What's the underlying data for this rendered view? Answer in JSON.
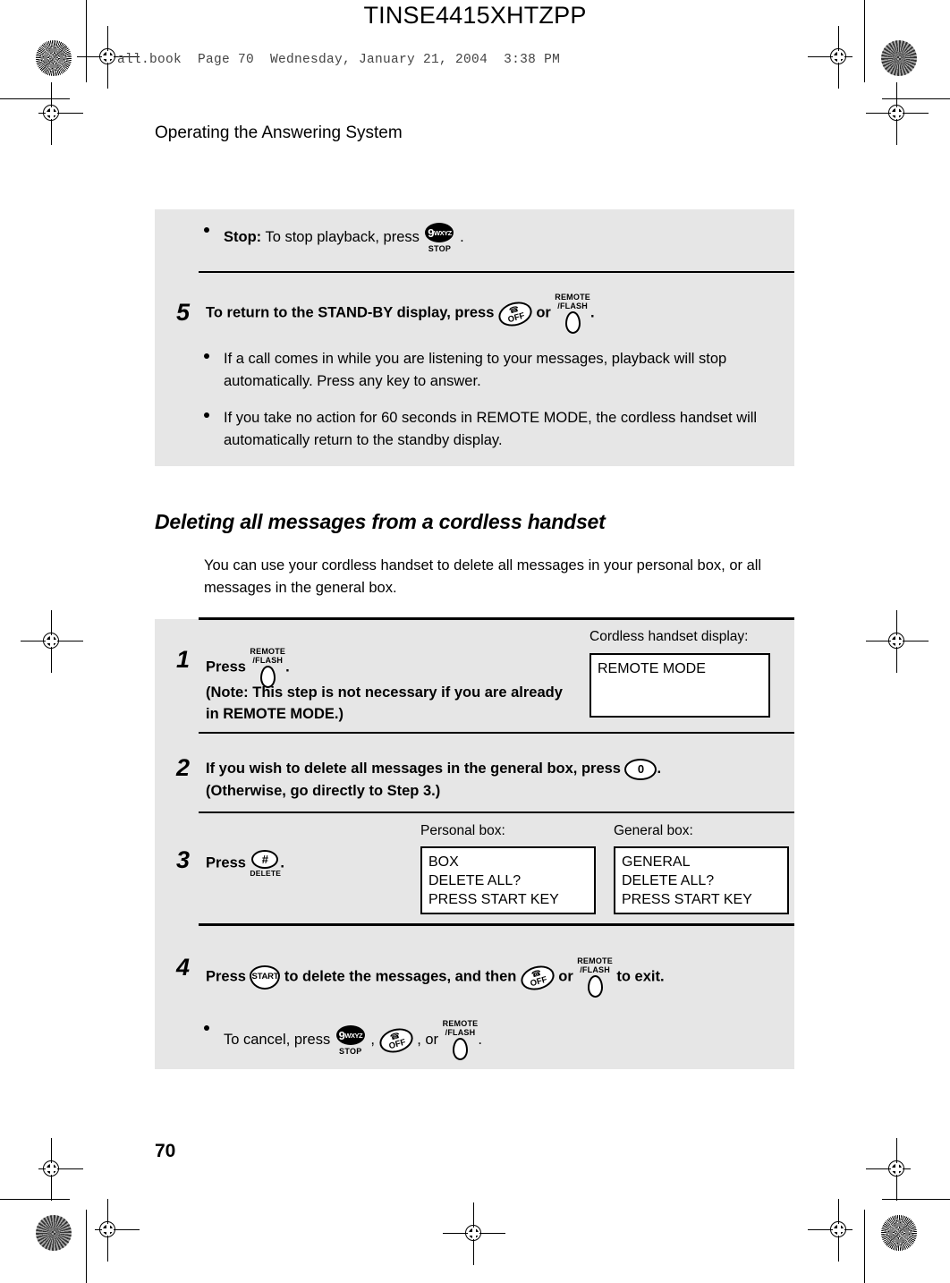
{
  "header": {
    "doc_code": "TINSE4415XHTZPP",
    "file_stamp": "all.book  Page 70  Wednesday, January 21, 2004  3:38 PM",
    "running_head": "Operating the Answering System"
  },
  "panel_top": {
    "stop_bullet": {
      "label": "Stop:",
      "text_before": "To stop playback, press",
      "key": "9-wxyz-stop-key",
      "text_after": "."
    },
    "step5": {
      "number": "5",
      "text_before": "To return to the STAND-BY display, press",
      "key1": "off-key",
      "conjunction": "or",
      "key2": "remote-flash-key",
      "text_after": ".",
      "bullets": [
        "If a call comes in while you are listening to your messages, playback will stop automatically. Press any key to answer.",
        "If you take no action for 60 seconds in REMOTE MODE, the cordless handset will automatically return to the standby display."
      ]
    }
  },
  "section": {
    "heading": "Deleting all messages from a cordless handset",
    "intro": "You can use your cordless handset to delete all messages in your personal box, or all messages in the general box."
  },
  "panel_steps": {
    "step1": {
      "number": "1",
      "press_label": "Press",
      "key": "remote-flash-key",
      "after_key": ".",
      "note": "(Note: This step is not necessary if you are already in REMOTE MODE.)",
      "display_label": "Cordless handset display:",
      "display_lines": [
        "REMOTE MODE"
      ]
    },
    "step2": {
      "number": "2",
      "text_before": "If you wish to delete all messages in the general box, press",
      "key": "zero-key",
      "text_after": ".",
      "line2": "(Otherwise, go directly to Step 3.)"
    },
    "step3": {
      "number": "3",
      "press_label": "Press",
      "key": "pound-delete-key",
      "after_key": ".",
      "personal_label": "Personal box:",
      "personal_lines": [
        "BOX",
        "DELETE ALL?",
        "PRESS START KEY"
      ],
      "general_label": "General box:",
      "general_lines": [
        "GENERAL",
        "DELETE ALL?",
        "PRESS START KEY"
      ]
    },
    "step4": {
      "number": "4",
      "press_label": "Press",
      "key_start": "start-key",
      "text_mid": "to delete the messages, and then",
      "key_off": "off-key",
      "conjunction": "or",
      "key_remote": "remote-flash-key",
      "text_end": "to exit.",
      "cancel_before": "To cancel, press",
      "cancel_k1": "9-wxyz-stop-key",
      "cancel_sep1": ",",
      "cancel_k2": "off-key",
      "cancel_sep2": ", or",
      "cancel_k3": "remote-flash-key",
      "cancel_end": "."
    }
  },
  "footer": {
    "page_number": "70"
  },
  "keys": {
    "nine": "9",
    "nine_sup": "WXYZ",
    "stop": "STOP",
    "off_label": "OFF",
    "phone_glyph": "☎",
    "remote_line1": "REMOTE",
    "remote_line2": "/FLASH",
    "zero": "0",
    "pound": "#",
    "delete": "DELETE",
    "start": "START"
  },
  "colors": {
    "panel_gray": "#e6e6e6",
    "ink": "#000000",
    "paper": "#ffffff"
  }
}
